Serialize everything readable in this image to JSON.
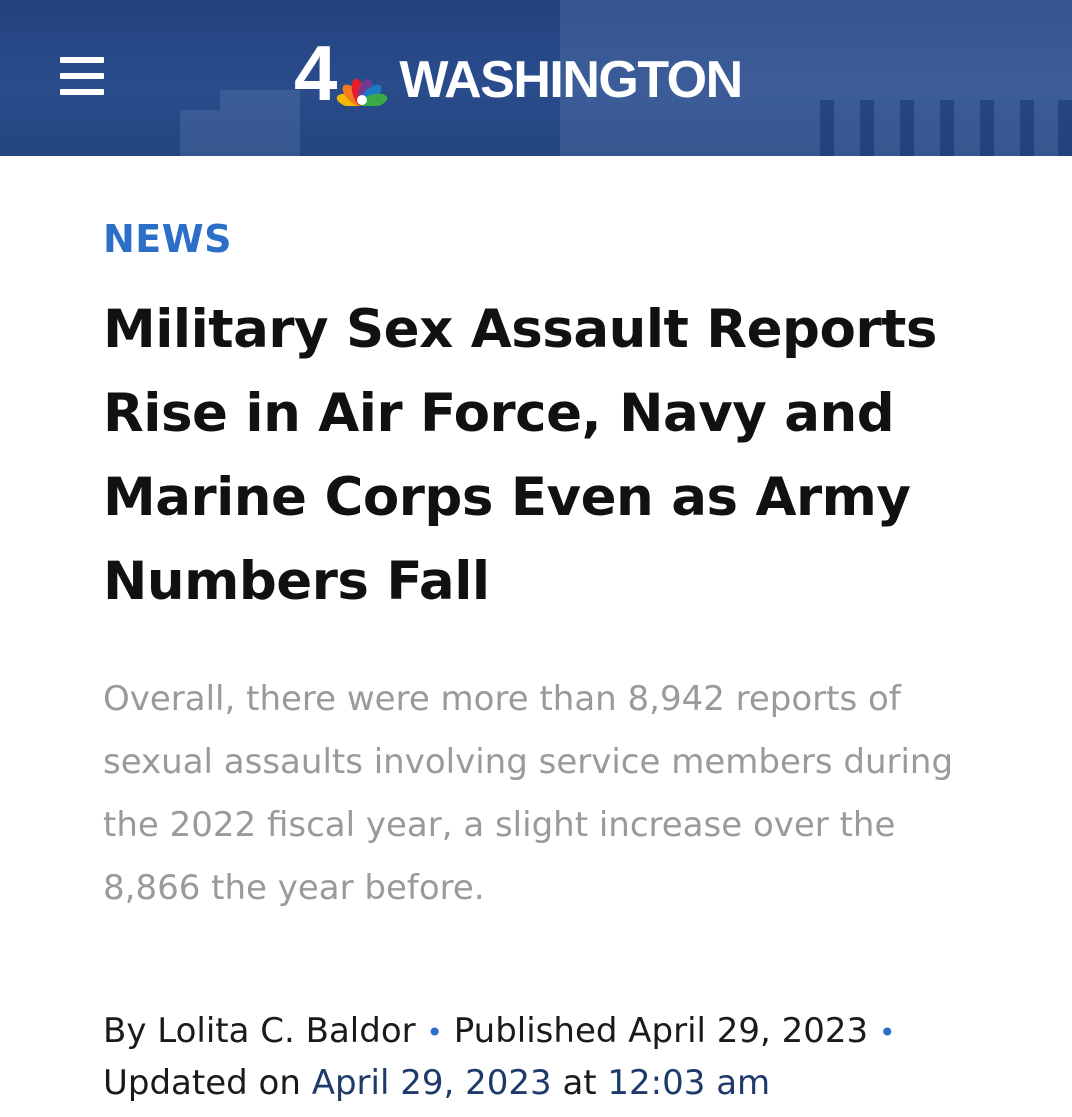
{
  "header": {
    "logo_number": "4",
    "logo_text": "WASHINGTON",
    "logo_colors": [
      "#f5b800",
      "#f47a20",
      "#e41e2a",
      "#6e3c96",
      "#1e7ac4",
      "#3aaa47"
    ],
    "background_color": "#23427f"
  },
  "article": {
    "category": "NEWS",
    "headline": "Military Sex Assault Reports Rise in Air Force, Navy and Marine Corps Even as Army Numbers Fall",
    "dek": "Overall, there were more than 8,942 reports of sexual assaults involving service members during the 2022 fiscal year, a slight increase over the 8,866 the year before.",
    "byline": {
      "by_prefix": "By",
      "author": "Lolita C. Baldor",
      "separator": "•",
      "published_prefix": "Published",
      "published_date": "April 29, 2023",
      "updated_prefix": "Updated on",
      "updated_date": "April 29, 2023",
      "at_word": "at",
      "updated_time": "12:03 am"
    }
  },
  "colors": {
    "accent_blue": "#2b6fc9",
    "headline_text": "#111111",
    "dek_text": "#9a9a9a"
  }
}
